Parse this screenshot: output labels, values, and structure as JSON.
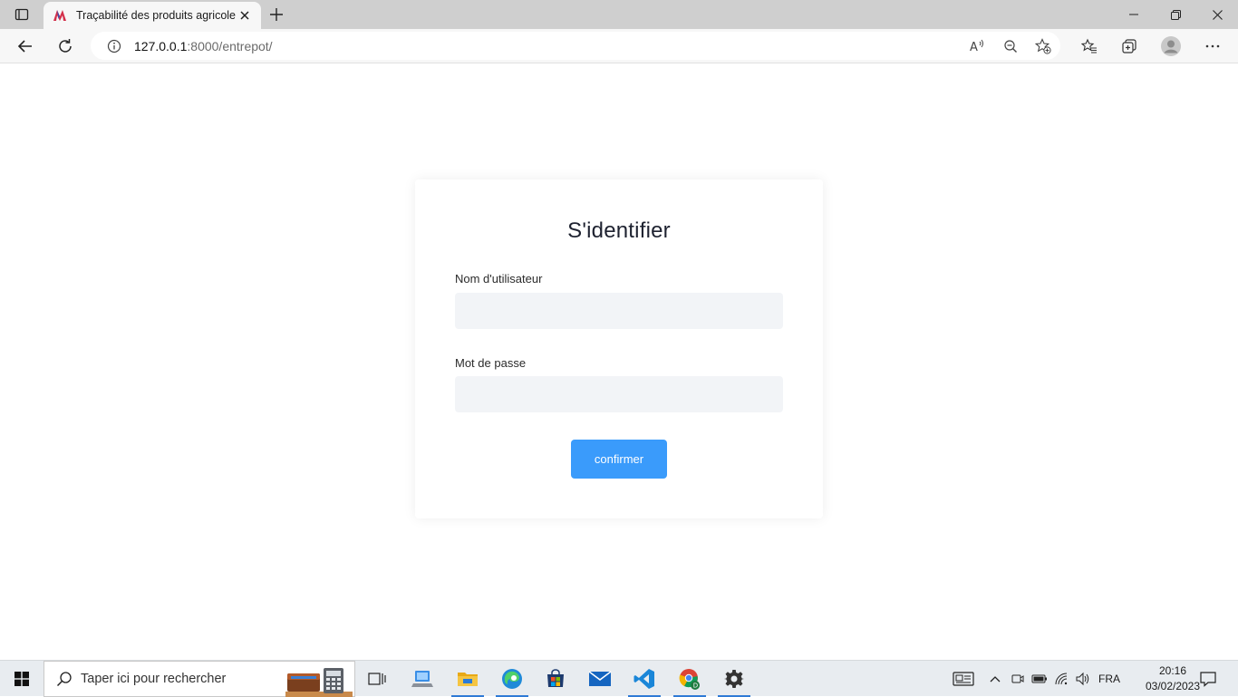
{
  "browser": {
    "tab": {
      "title": "Traçabilité des produits agricoles"
    },
    "address_bar": {
      "url_host": "127.0.0.1",
      "url_rest": ":8000/entrepot/"
    }
  },
  "login": {
    "title": "S'identifier",
    "username_label": "Nom d'utilisateur",
    "username_value": "",
    "password_label": "Mot de passe",
    "password_value": "",
    "confirm_label": "confirmer"
  },
  "taskbar": {
    "search_placeholder": "Taper ici pour rechercher",
    "language": "FRA",
    "time": "20:16",
    "date": "03/02/2023"
  },
  "colors": {
    "accent": "#3a9bfb",
    "input_bg": "#f2f4f7",
    "title_text": "#1e2230"
  }
}
